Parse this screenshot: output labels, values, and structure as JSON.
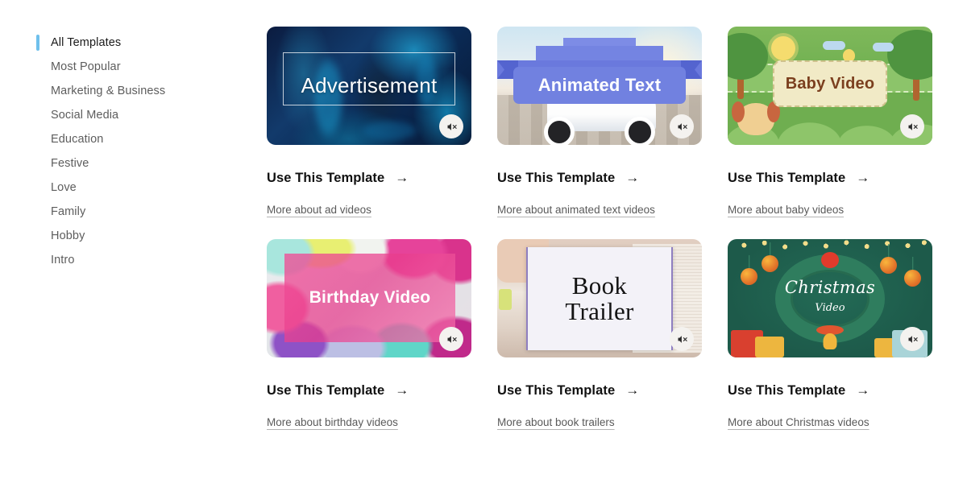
{
  "sidebar": {
    "items": [
      {
        "label": "All Templates",
        "active": true
      },
      {
        "label": "Most Popular",
        "active": false
      },
      {
        "label": "Marketing & Business",
        "active": false
      },
      {
        "label": "Social Media",
        "active": false
      },
      {
        "label": "Education",
        "active": false
      },
      {
        "label": "Festive",
        "active": false
      },
      {
        "label": "Love",
        "active": false
      },
      {
        "label": "Family",
        "active": false
      },
      {
        "label": "Hobby",
        "active": false
      },
      {
        "label": "Intro",
        "active": false
      }
    ],
    "active_indicator_color": "#6fc0ec"
  },
  "common": {
    "cta_label": "Use This Template",
    "cta_arrow": "→",
    "mute_icon": "speaker-muted-icon"
  },
  "cards": [
    {
      "thumb_title": "Advertisement",
      "cta_label": "Use This Template",
      "more_link": "More about ad videos",
      "accent": "#0b1b3f"
    },
    {
      "thumb_title": "Animated Text",
      "cta_label": "Use This Template",
      "more_link": "More about animated text videos",
      "accent": "#7181e0"
    },
    {
      "thumb_title": "Baby Video",
      "cta_label": "Use This Template",
      "more_link": "More about baby videos",
      "accent": "#7fb85a"
    },
    {
      "thumb_title": "Birthday Video",
      "cta_label": "Use This Template",
      "more_link": "More about birthday videos",
      "accent": "#e83c8c"
    },
    {
      "thumb_title_line1": "Book",
      "thumb_title_line2": "Trailer",
      "cta_label": "Use This Template",
      "more_link": "More about book trailers",
      "accent": "#8f7fc0"
    },
    {
      "thumb_title": "Christmas",
      "thumb_subtitle": "Video",
      "cta_label": "Use This Template",
      "more_link": "More about Christmas videos",
      "accent": "#1d5a4a"
    }
  ]
}
